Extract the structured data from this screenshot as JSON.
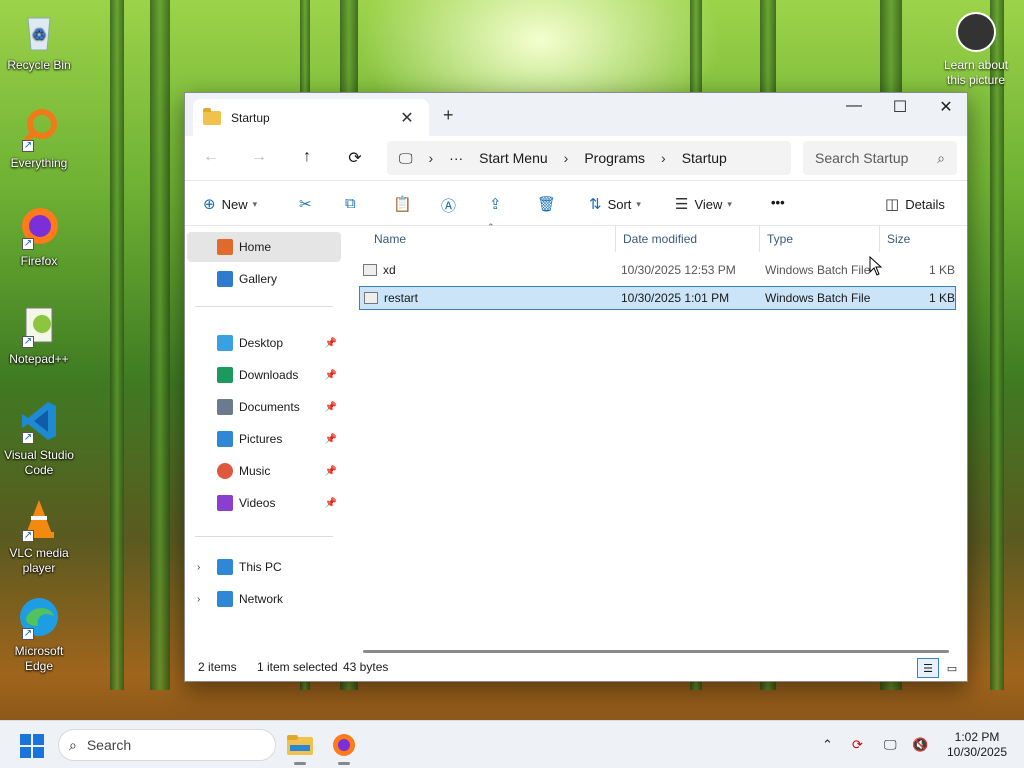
{
  "desktop": {
    "icons": [
      {
        "label": "Recycle Bin"
      },
      {
        "label": "Everything"
      },
      {
        "label": "Firefox"
      },
      {
        "label": "Notepad++"
      },
      {
        "label": "Visual Studio Code"
      },
      {
        "label": "VLC media player"
      },
      {
        "label": "Microsoft Edge"
      }
    ],
    "learn_label": "Learn about this picture"
  },
  "window": {
    "tab_title": "Startup",
    "new_tab": "+",
    "controls": {
      "minimize": "—",
      "maximize": "☐",
      "close": "✕"
    },
    "nav": {
      "back": "←",
      "forward": "→",
      "up": "↑",
      "refresh": "⟳"
    },
    "breadcrumb": [
      "Start Menu",
      "Programs",
      "Startup"
    ],
    "search_placeholder": "Search Startup",
    "toolbar": {
      "new_label": "New",
      "sort_label": "Sort",
      "view_label": "View",
      "more_label": "•••",
      "details_label": "Details"
    },
    "sidebar": {
      "quick": [
        {
          "label": "Home",
          "color": "#e06a2b"
        },
        {
          "label": "Gallery",
          "color": "#2f7bd0"
        }
      ],
      "pinned": [
        {
          "label": "Desktop",
          "color": "#3aa0e4"
        },
        {
          "label": "Downloads",
          "color": "#1b9a5b"
        },
        {
          "label": "Documents",
          "color": "#6b7a8f"
        },
        {
          "label": "Pictures",
          "color": "#2f88d6"
        },
        {
          "label": "Music",
          "color": "#e0573f"
        },
        {
          "label": "Videos",
          "color": "#8a3fd0"
        }
      ],
      "drives": [
        {
          "label": "This PC",
          "color": "#2f88d6"
        },
        {
          "label": "Network",
          "color": "#2f88d6"
        }
      ]
    },
    "columns": {
      "name": "Name",
      "date": "Date modified",
      "type": "Type",
      "size": "Size"
    },
    "files": [
      {
        "name": "xd",
        "date": "10/30/2025 12:53 PM",
        "type": "Windows Batch File",
        "size": "1 KB"
      },
      {
        "name": "restart",
        "date": "10/30/2025 1:01 PM",
        "type": "Windows Batch File",
        "size": "1 KB"
      }
    ],
    "status": {
      "items": "2 items",
      "selected": "1 item selected",
      "bytes": "43 bytes"
    }
  },
  "taskbar": {
    "search_label": "Search",
    "clock_time": "1:02 PM",
    "clock_date": "10/30/2025"
  }
}
